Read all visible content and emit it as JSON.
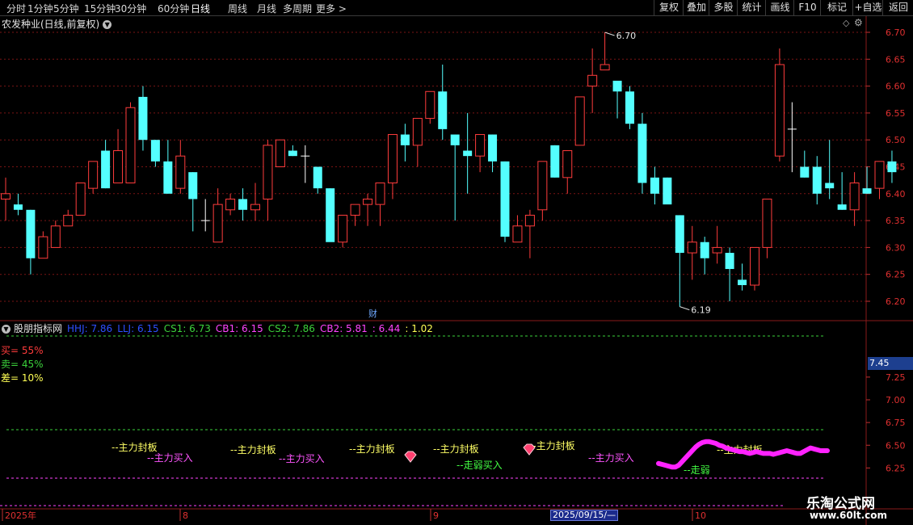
{
  "toolbar": {
    "periods": [
      "分时",
      "1分钟",
      "5分钟",
      "15分钟",
      "30分钟",
      "60分钟",
      "日线",
      "周线",
      "月线",
      "多周期",
      "更多 >"
    ],
    "active_period": "日线",
    "right_buttons": [
      "复权",
      "叠加",
      "多股",
      "统计",
      "画线",
      "F10",
      "标记",
      "+自选",
      "返回"
    ]
  },
  "title": "农发种业(日线,前复权)",
  "indicator": {
    "name": "股朋指标网",
    "values": [
      {
        "label": "HHJ: 7.86",
        "color": "#2d4fff"
      },
      {
        "label": "LLJ: 6.15",
        "color": "#2d4fff"
      },
      {
        "label": "CS1: 6.73",
        "color": "#3bd23b"
      },
      {
        "label": "CB1: 6.15",
        "color": "#ff44ff"
      },
      {
        "label": "CS2: 7.86",
        "color": "#3bd23b"
      },
      {
        "label": "CB2: 5.81",
        "color": "#ff44ff"
      },
      {
        "label": ": 6.44",
        "color": "#ff44ff"
      },
      {
        "label": ": 1.02",
        "color": "#ffff55"
      }
    ],
    "buy_pct": "买= 55%",
    "sell_pct": "卖= 45%",
    "diff_pct": "差= 10%",
    "current_value": "7.45"
  },
  "chart_data": {
    "type": "candlestick",
    "ylim": [
      6.16,
      6.73
    ],
    "y_ticks": [
      "6.70",
      "6.65",
      "6.60",
      "6.55",
      "6.50",
      "6.45",
      "6.40",
      "6.35",
      "6.30",
      "6.25",
      "6.20"
    ],
    "candles": [
      [
        6.39,
        6.43,
        6.35,
        6.4
      ],
      [
        6.38,
        6.4,
        6.36,
        6.37
      ],
      [
        6.37,
        6.37,
        6.25,
        6.28
      ],
      [
        6.28,
        6.33,
        6.28,
        6.32
      ],
      [
        6.3,
        6.35,
        6.3,
        6.34
      ],
      [
        6.34,
        6.37,
        6.34,
        6.36
      ],
      [
        6.36,
        6.42,
        6.36,
        6.42
      ],
      [
        6.41,
        6.46,
        6.4,
        6.46
      ],
      [
        6.48,
        6.5,
        6.41,
        6.41
      ],
      [
        6.42,
        6.52,
        6.42,
        6.48
      ],
      [
        6.42,
        6.57,
        6.42,
        6.56
      ],
      [
        6.58,
        6.6,
        6.48,
        6.5
      ],
      [
        6.5,
        6.5,
        6.45,
        6.46
      ],
      [
        6.46,
        6.5,
        6.4,
        6.4
      ],
      [
        6.41,
        6.5,
        6.4,
        6.47
      ],
      [
        6.44,
        6.44,
        6.33,
        6.39
      ],
      [
        6.35,
        6.39,
        6.33,
        6.35
      ],
      [
        6.31,
        6.41,
        6.31,
        6.38
      ],
      [
        6.37,
        6.4,
        6.36,
        6.39
      ],
      [
        6.39,
        6.41,
        6.35,
        6.37
      ],
      [
        6.37,
        6.42,
        6.35,
        6.38
      ],
      [
        6.39,
        6.5,
        6.35,
        6.49
      ],
      [
        6.45,
        6.5,
        6.45,
        6.5
      ],
      [
        6.48,
        6.49,
        6.47,
        6.47
      ],
      [
        6.47,
        6.49,
        6.42,
        6.47
      ],
      [
        6.45,
        6.45,
        6.4,
        6.41
      ],
      [
        6.41,
        6.41,
        6.32,
        6.31
      ],
      [
        6.31,
        6.35,
        6.3,
        6.36
      ],
      [
        6.36,
        6.38,
        6.34,
        6.38
      ],
      [
        6.38,
        6.4,
        6.34,
        6.39
      ],
      [
        6.38,
        6.42,
        6.34,
        6.42
      ],
      [
        6.42,
        6.51,
        6.39,
        6.51
      ],
      [
        6.51,
        6.53,
        6.46,
        6.49
      ],
      [
        6.49,
        6.54,
        6.45,
        6.54
      ],
      [
        6.54,
        6.59,
        6.53,
        6.59
      ],
      [
        6.59,
        6.64,
        6.5,
        6.52
      ],
      [
        6.51,
        6.51,
        6.35,
        6.49
      ],
      [
        6.48,
        6.55,
        6.4,
        6.47
      ],
      [
        6.47,
        6.5,
        6.44,
        6.51
      ],
      [
        6.51,
        6.51,
        6.44,
        6.46
      ],
      [
        6.46,
        6.46,
        6.31,
        6.32
      ],
      [
        6.31,
        6.36,
        6.31,
        6.34
      ],
      [
        6.34,
        6.37,
        6.28,
        6.36
      ],
      [
        6.37,
        6.46,
        6.35,
        6.46
      ],
      [
        6.49,
        6.49,
        6.43,
        6.43
      ],
      [
        6.43,
        6.48,
        6.4,
        6.48
      ],
      [
        6.49,
        6.58,
        6.49,
        6.58
      ],
      [
        6.6,
        6.67,
        6.55,
        6.62
      ],
      [
        6.63,
        6.7,
        6.63,
        6.64
      ],
      [
        6.61,
        6.6,
        6.54,
        6.59
      ],
      [
        6.59,
        6.6,
        6.52,
        6.53
      ],
      [
        6.53,
        6.55,
        6.4,
        6.42
      ],
      [
        6.43,
        6.45,
        6.38,
        6.4
      ],
      [
        6.43,
        6.43,
        6.39,
        6.38
      ],
      [
        6.36,
        6.36,
        6.19,
        6.29
      ],
      [
        6.29,
        6.34,
        6.24,
        6.31
      ],
      [
        6.31,
        6.32,
        6.25,
        6.28
      ],
      [
        6.29,
        6.34,
        6.27,
        6.3
      ],
      [
        6.29,
        6.3,
        6.2,
        6.26
      ],
      [
        6.24,
        6.27,
        6.22,
        6.23
      ],
      [
        6.23,
        6.29,
        6.22,
        6.3
      ],
      [
        6.3,
        6.39,
        6.28,
        6.39
      ],
      [
        6.47,
        6.67,
        6.46,
        6.64
      ],
      [
        6.52,
        6.57,
        6.44,
        6.52
      ],
      [
        6.45,
        6.48,
        6.43,
        6.43
      ],
      [
        6.45,
        6.47,
        6.38,
        6.4
      ],
      [
        6.42,
        6.5,
        6.39,
        6.41
      ],
      [
        6.38,
        6.44,
        6.37,
        6.37
      ],
      [
        6.37,
        6.44,
        6.34,
        6.42
      ],
      [
        6.41,
        6.45,
        6.4,
        6.4
      ],
      [
        6.41,
        6.46,
        6.39,
        6.46
      ],
      [
        6.46,
        6.48,
        6.42,
        6.44
      ]
    ],
    "marked_high": "6.70",
    "marked_low": "6.19",
    "finance_marker": "财",
    "indicator_ylim": [
      6.12,
      7.72
    ],
    "indicator_ticks": [
      "7.25",
      "7.00",
      "6.75",
      "6.50",
      "6.25"
    ],
    "indicator_line_values": [
      6.3,
      6.29,
      6.28,
      6.27,
      6.26,
      6.26,
      6.28,
      6.32,
      6.36,
      6.4,
      6.44,
      6.48,
      6.51,
      6.53,
      6.54,
      6.54,
      6.53,
      6.52,
      6.5,
      6.49,
      6.47,
      6.46,
      6.45,
      6.44,
      6.43,
      6.43,
      6.42,
      6.41,
      6.42,
      6.43,
      6.42,
      6.41,
      6.41,
      6.41,
      6.4,
      6.41,
      6.42,
      6.43,
      6.44,
      6.43,
      6.42,
      6.41,
      6.41,
      6.43,
      6.45,
      6.47,
      6.46,
      6.45,
      6.44,
      6.44,
      6.44
    ],
    "annotations": [
      {
        "text": "--主力封板",
        "color": "#ffff66",
        "pos": [
          138,
          548
        ]
      },
      {
        "text": "--主力买入",
        "color": "#ff55ff",
        "pos": [
          182,
          561
        ]
      },
      {
        "text": "--主力封板",
        "color": "#ffff66",
        "pos": [
          285,
          551
        ]
      },
      {
        "text": "--主力买入",
        "color": "#ff55ff",
        "pos": [
          345,
          562
        ]
      },
      {
        "text": "--主力封板",
        "color": "#ffff66",
        "pos": [
          432,
          550
        ]
      },
      {
        "text": "--主力封板",
        "color": "#ffff66",
        "pos": [
          536,
          550
        ]
      },
      {
        "text": "--走弱买入",
        "color": "#44ff44",
        "pos": [
          565,
          570
        ]
      },
      {
        "text": "--主力封板",
        "color": "#ffff66",
        "pos": [
          655,
          546
        ]
      },
      {
        "text": "--主力买入",
        "color": "#ff55ff",
        "pos": [
          728,
          561
        ]
      },
      {
        "text": "--走弱",
        "color": "#44ff44",
        "pos": [
          846,
          576
        ]
      },
      {
        "text": "--主力封板",
        "color": "#ffff66",
        "pos": [
          887,
          551
        ]
      }
    ],
    "x_axis_labels": [
      "2025年",
      "8",
      "9",
      "10"
    ],
    "cursor_date": "2025/09/15/—"
  },
  "watermark": {
    "line1": "乐淘公式网",
    "line2": "www.60lt.com"
  },
  "colors": {
    "up": "#ff3c3c",
    "down": "#54ffff",
    "grid": "#7a1414"
  }
}
